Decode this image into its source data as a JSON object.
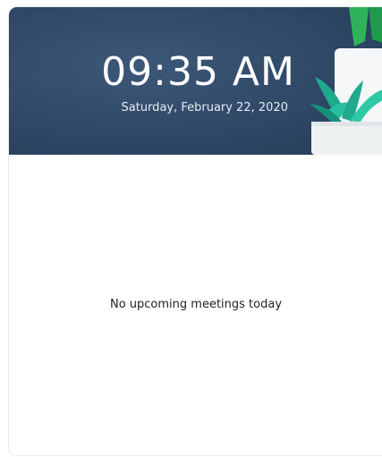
{
  "header": {
    "time": "09:35 AM",
    "date": "Saturday, February 22, 2020",
    "illustration_icon": "potted-plant-icon",
    "background_color": "#2f4866"
  },
  "meetings": {
    "empty_message": "No upcoming meetings today"
  }
}
